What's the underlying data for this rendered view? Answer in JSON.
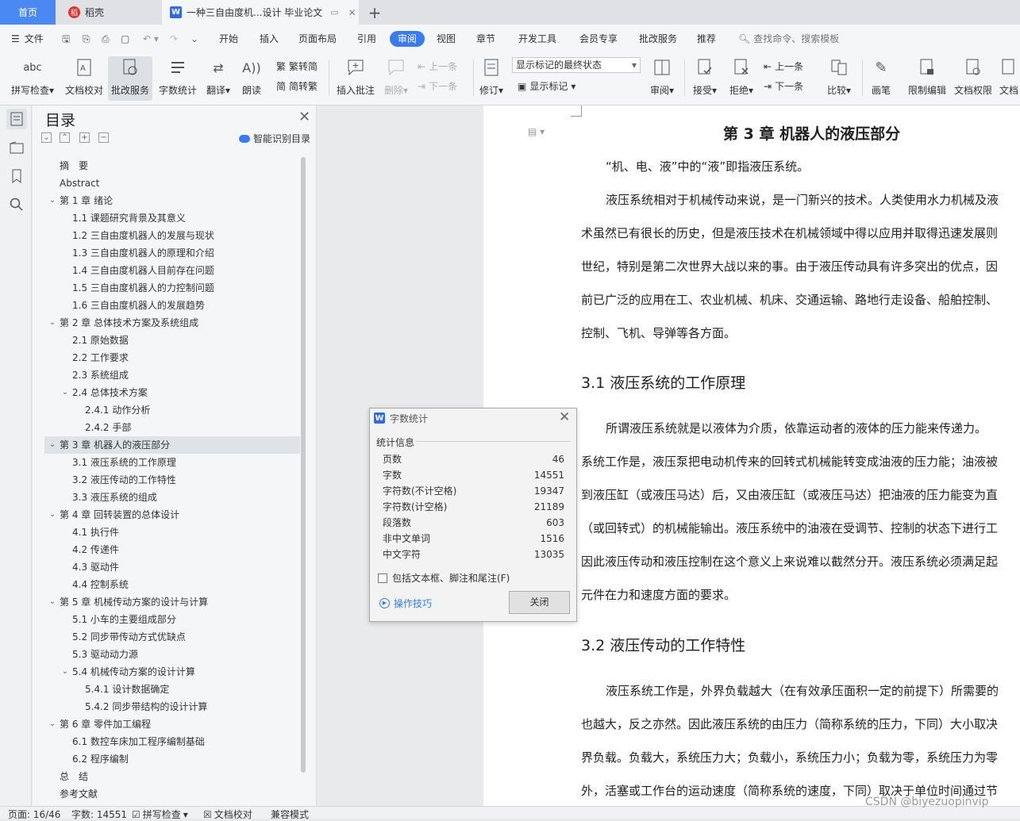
{
  "tabs": {
    "home": "首页",
    "daoke": "稻壳",
    "doc": "一种三自由度机...设计 毕业论文",
    "add": "+"
  },
  "menu": {
    "file": "文件",
    "items": [
      "开始",
      "插入",
      "页面布局",
      "引用",
      "审阅",
      "视图",
      "章节",
      "开发工具",
      "会员专享",
      "批改服务",
      "推荐"
    ],
    "search": "查找命令、搜索模板"
  },
  "ribbon": {
    "spell": "拼写检查",
    "proof": "文档校对",
    "correct": "批改服务",
    "wordcount": "字数统计",
    "translate": "翻译",
    "read": "朗读",
    "trad": "繁转简",
    "simp": "简转繁",
    "insert_comment": "插入批注",
    "delete": "删除",
    "prev": "上一条",
    "next": "下一条",
    "revise": "修订",
    "markup_select": "显示标记的最终状态",
    "show_markup": "显示标记",
    "review": "审阅",
    "accept": "接受",
    "reject": "拒绝",
    "prev2": "上一条",
    "next2": "下一条",
    "compare": "比较",
    "pen": "画笔",
    "restrict": "限制编辑",
    "rights": "文档权限",
    "doc": "文档"
  },
  "toc": {
    "title": "目录",
    "smart": "智能识别目录",
    "items": [
      {
        "text": "摘　要"
      },
      {
        "text": "Abstract"
      },
      {
        "text": "第 1 章  绪论"
      },
      {
        "text": "1.1 课题研究背景及其意义"
      },
      {
        "text": "1.2 三自由度机器人的发展与现状"
      },
      {
        "text": "1.3 三自由度机器人的原理和介绍"
      },
      {
        "text": "1.4 三自由度机器人目前存在问题"
      },
      {
        "text": "1.5 三自由度机器人的力控制问题"
      },
      {
        "text": "1.6 三自由度机器人的发展趋势"
      },
      {
        "text": "第 2 章  总体技术方案及系统组成"
      },
      {
        "text": "2.1 原始数据"
      },
      {
        "text": "2.2 工作要求"
      },
      {
        "text": "2.3 系统组成"
      },
      {
        "text": "2.4 总体技术方案"
      },
      {
        "text": "2.4.1  动作分析"
      },
      {
        "text": "2.4.2  手部"
      },
      {
        "text": "第 3 章  机器人的液压部分"
      },
      {
        "text": "3.1 液压系统的工作原理"
      },
      {
        "text": "3.2 液压传动的工作特性"
      },
      {
        "text": "3.3 液压系统的组成"
      },
      {
        "text": "第 4 章  回转装置的总体设计"
      },
      {
        "text": "4.1 执行件"
      },
      {
        "text": "4.2 传递件"
      },
      {
        "text": "4.3 驱动件"
      },
      {
        "text": "4.4 控制系统"
      },
      {
        "text": "第 5 章  机械传动方案的设计与计算"
      },
      {
        "text": "5.1 小车的主要组成部分"
      },
      {
        "text": "5.2 同步带传动方式优缺点"
      },
      {
        "text": "5.3 驱动动力源"
      },
      {
        "text": "5.4 机械传动方案的设计计算"
      },
      {
        "text": "5.4.1 设计数据确定"
      },
      {
        "text": "5.4.2 同步带结构的设计计算"
      },
      {
        "text": "第 6 章  零件加工编程"
      },
      {
        "text": "6.1 数控车床加工程序编制基础"
      },
      {
        "text": "6.2 程序编制"
      },
      {
        "text": "总　结"
      },
      {
        "text": "参考文献"
      }
    ]
  },
  "page": {
    "chapter": "第 3 章  机器人的液压部分",
    "lines": [
      "“机、电、液”中的“液”即指液压系统。",
      "液压系统相对于机械传动来说，是一门新兴的技术。人类使用水力机械及液",
      "术虽然已有很长的历史，但是液压技术在机械领域中得以应用并取得迅速发展则",
      "世纪，特别是第二次世界大战以来的事。由于液压传动具有许多突出的优点，因",
      "前已广泛的应用在工、农业机械、机床、交通运输、路地行走设备、船舶控制、",
      "控制、飞机、导弹等各方面。"
    ],
    "h31": "3.1 液压系统的工作原理",
    "lines2": [
      "所谓液压系统就是以液体为介质，依靠运动者的液体的压力能来传递力。",
      "系统工作是，液压泵把电动机传来的回转式机械能转变成油液的压力能；油液被",
      "到液压缸（或液压马达）后，又由液压缸（或液压马达）把油液的压力能变为直",
      "（或回转式）的机械能输出。液压系统中的油液在受调节、控制的状态下进行工",
      "因此液压传动和液压控制在这个意义上来说难以截然分开。液压系统必须满足起",
      "元件在力和速度方面的要求。"
    ],
    "h32": "3.2 液压传动的工作特性",
    "lines3": [
      "液压系统工作是，外界负载越大（在有效承压面积一定的前提下）所需要的",
      "也越大，反之亦然。因此液压系统的由压力（简称系统的压力，下同）大小取决",
      "界负载。负载大，系统压力大；负载小，系统压力小；负载为零，系统压力为零",
      "外，活塞或工作台的运动速度（简称系统的速度，下同）取决于单位时间通过节"
    ]
  },
  "dialog": {
    "title": "字数统计",
    "group": "统计信息",
    "rows": [
      {
        "label": "页数",
        "value": "46"
      },
      {
        "label": "字数",
        "value": "14551"
      },
      {
        "label": "字符数(不计空格)",
        "value": "19347"
      },
      {
        "label": "字符数(计空格)",
        "value": "21189"
      },
      {
        "label": "段落数",
        "value": "603"
      },
      {
        "label": "非中文单词",
        "value": "1516"
      },
      {
        "label": "中文字符",
        "value": "13035"
      }
    ],
    "checkbox": "包括文本框、脚注和尾注(F)",
    "tips": "操作技巧",
    "close": "关闭"
  },
  "status": {
    "page": "页面: 16/46",
    "words": "字数: 14551",
    "spell": "拼写检查",
    "proof": "文档校对",
    "compat": "兼容模式"
  },
  "watermark": "CSDN @biyezuopinvip",
  "colors": {
    "accent": "#3a7af2",
    "home_tab": "#4a89f3"
  }
}
